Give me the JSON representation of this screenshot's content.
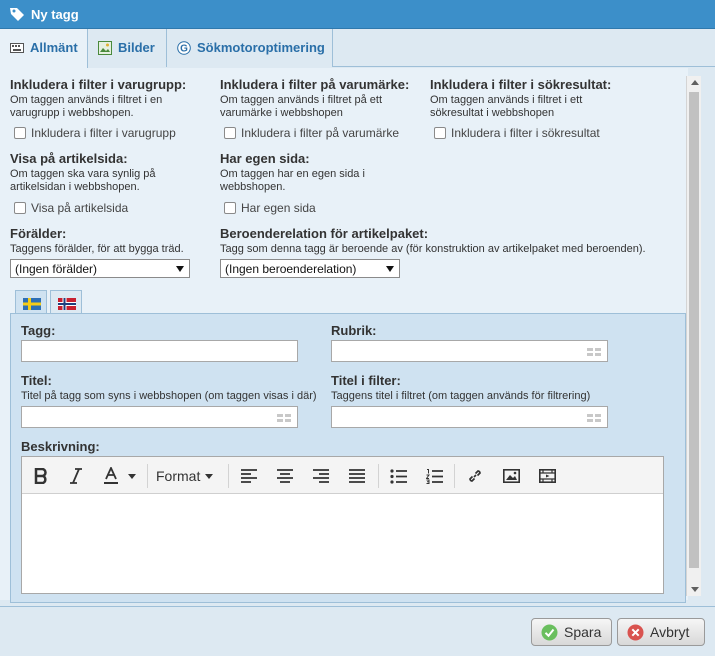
{
  "window": {
    "title": "Ny tagg"
  },
  "tabs": [
    {
      "label": "Allmänt",
      "icon": "keyboard-icon"
    },
    {
      "label": "Bilder",
      "icon": "image-icon"
    },
    {
      "label": "Sökmotoroptimering",
      "icon": "google-icon"
    }
  ],
  "filters": {
    "varugrupp": {
      "title": "Inkludera i filter i varugrupp:",
      "desc": "Om taggen används i filtret i en varugrupp i webbshopen.",
      "checkbox": "Inkludera i filter i varugrupp"
    },
    "varumarke": {
      "title": "Inkludera i filter på varumärke:",
      "desc": "Om taggen används i filtret på ett varumärke i webbshopen",
      "checkbox": "Inkludera i filter på varumärke"
    },
    "sokresultat": {
      "title": "Inkludera i filter i sökresultat:",
      "desc": "Om taggen används i filtret i ett sökresultat i webbshopen",
      "checkbox": "Inkludera i filter i sökresultat"
    }
  },
  "display": {
    "artikelsida": {
      "title": "Visa på artikelsida:",
      "desc": "Om taggen ska vara synlig på artikelsidan i webbshopen.",
      "checkbox": "Visa på artikelsida"
    },
    "egensida": {
      "title": "Har egen sida:",
      "desc": "Om taggen har en egen sida i webbshopen.",
      "checkbox": "Har egen sida"
    }
  },
  "parent": {
    "title": "Förälder:",
    "desc": "Taggens förälder, för att bygga träd.",
    "selected": "(Ingen förälder)"
  },
  "dependency": {
    "title": "Beroenderelation för artikelpaket:",
    "desc": "Tagg som denna tagg är beroende av (för konstruktion av artikelpaket med beroenden).",
    "selected": "(Ingen beroenderelation)"
  },
  "language_tabs": [
    {
      "icon": "swedish-flag-icon"
    },
    {
      "icon": "norwegian-flag-icon"
    }
  ],
  "fields": {
    "tagg": {
      "label": "Tagg:",
      "value": ""
    },
    "rubrik": {
      "label": "Rubrik:",
      "value": ""
    },
    "titel": {
      "label": "Titel:",
      "desc": "Titel på tagg som syns i webbshopen (om taggen visas i där)",
      "value": ""
    },
    "titel_filter": {
      "label": "Titel i filter:",
      "desc": "Taggens titel i filtret (om taggen används för filtrering)",
      "value": ""
    },
    "beskrivning": {
      "label": "Beskrivning:"
    }
  },
  "editor": {
    "format_label": "Format"
  },
  "footer": {
    "save_label": "Spara",
    "cancel_label": "Avbryt"
  },
  "colors": {
    "titlebar": "#3c8fc9",
    "tab_text": "#2a6fa8",
    "panel": "#cfe2f1",
    "save": "#5cb85c",
    "cancel": "#d9534f"
  }
}
